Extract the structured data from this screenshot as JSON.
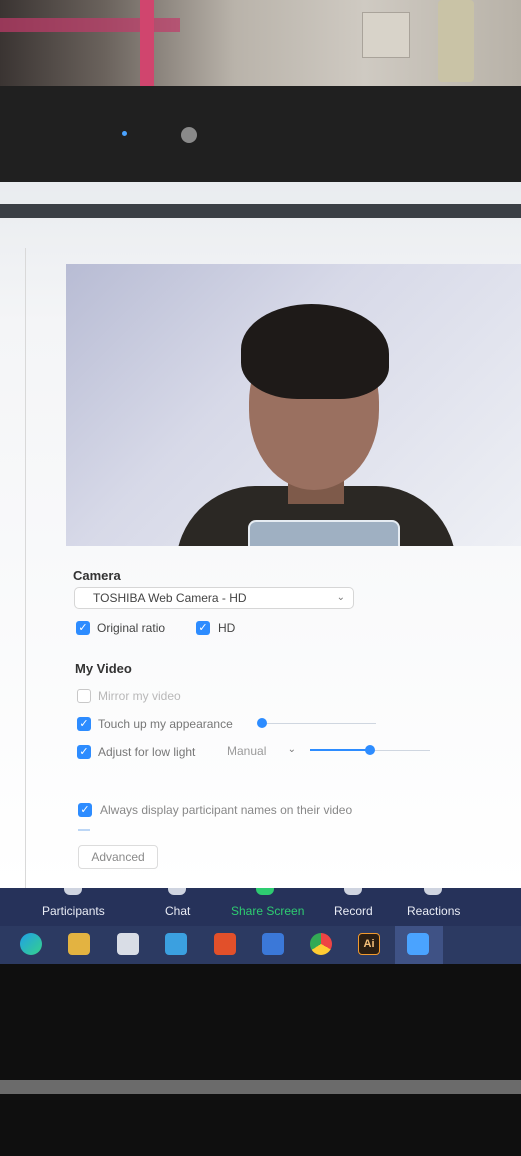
{
  "settings": {
    "camera_title": "Camera",
    "camera_value": "TOSHIBA Web Camera - HD",
    "original_ratio": "Original ratio",
    "hd": "HD",
    "my_video_title": "My Video",
    "mirror": "Mirror my video",
    "touch_up": "Touch up my appearance",
    "touch_up_level": 0,
    "low_light": "Adjust for low light",
    "low_light_mode": "Manual",
    "low_light_level": 0.5,
    "always_display": "Always display participant names on their video",
    "advanced": "Advanced"
  },
  "toolbar": {
    "participants": "Participants",
    "chat": "Chat",
    "share_screen": "Share Screen",
    "record": "Record",
    "reactions": "Reactions"
  },
  "taskbar": {
    "ai_label": "Ai",
    "icons": [
      "edge-icon",
      "file-explorer-icon",
      "store-icon",
      "mail-icon",
      "office-icon",
      "word-icon",
      "chrome-icon",
      "illustrator-icon",
      "zoom-icon"
    ]
  },
  "colors": {
    "accent": "#2d8cff",
    "toolbar_bg": "#26325a",
    "share_green": "#2ecc71"
  }
}
